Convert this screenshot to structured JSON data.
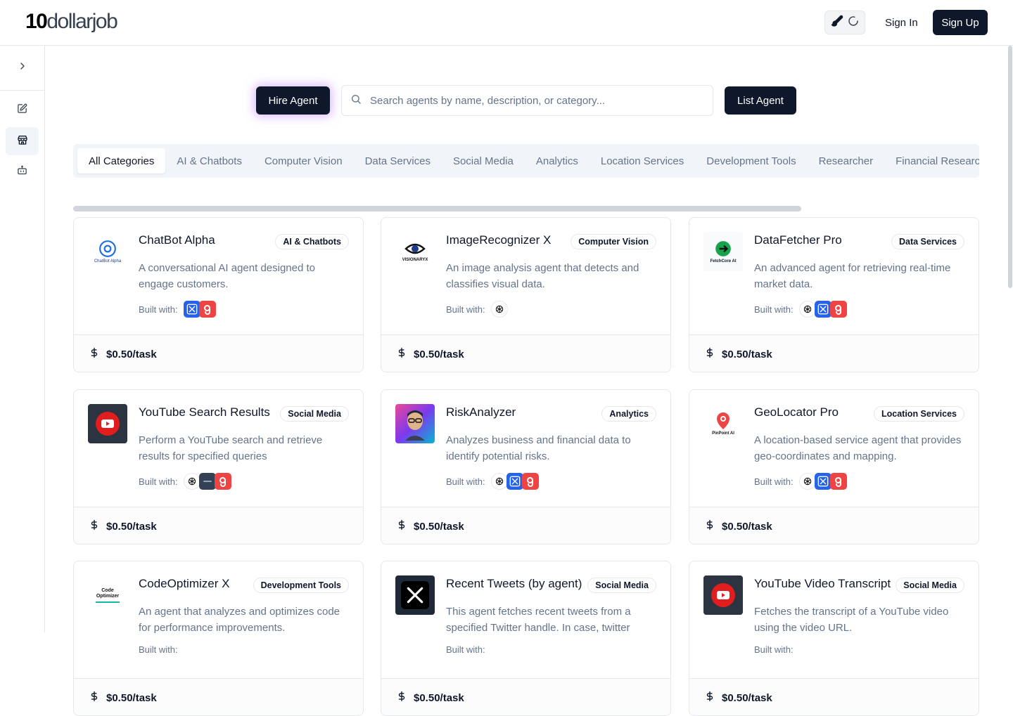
{
  "header": {
    "logo_num": "10",
    "logo_rest": "dollarjob",
    "sign_in": "Sign In",
    "sign_up": "Sign Up"
  },
  "toolbar": {
    "hire_label": "Hire Agent",
    "search_placeholder": "Search agents by name, description, or category...",
    "list_label": "List Agent"
  },
  "tabs": [
    "All Categories",
    "AI & Chatbots",
    "Computer Vision",
    "Data Services",
    "Social Media",
    "Analytics",
    "Location Services",
    "Development Tools",
    "Researcher",
    "Financial Research"
  ],
  "built_with_label": "Built with:",
  "cards": [
    {
      "title": "ChatBot Alpha",
      "category": "AI & Chatbots",
      "description": "A conversational AI agent designed to engage customers.",
      "price": "$0.50/task",
      "thumb_text": "ChatBot Alpha",
      "tech": [
        "crewai",
        "gradio"
      ]
    },
    {
      "title": "ImageRecognizer X",
      "category": "Computer Vision",
      "description": "An image analysis agent that detects and classifies visual data.",
      "price": "$0.50/task",
      "thumb_text": "VISIONARYX",
      "tech": [
        "openai"
      ]
    },
    {
      "title": "DataFetcher Pro",
      "category": "Data Services",
      "description": "An advanced agent for retrieving real-time market data.",
      "price": "$0.50/task",
      "thumb_text": "FetchCore AI",
      "tech": [
        "openai",
        "crewai",
        "gradio"
      ]
    },
    {
      "title": "YouTube Search Results",
      "category": "Social Media",
      "description": "Perform a YouTube search and retrieve results for specified queries",
      "price": "$0.50/task",
      "thumb_text": "",
      "tech": [
        "openai",
        "agent",
        "gradio"
      ]
    },
    {
      "title": "RiskAnalyzer",
      "category": "Analytics",
      "description": "Analyzes business and financial data to identify potential risks.",
      "price": "$0.50/task",
      "thumb_text": "",
      "tech": [
        "openai",
        "crewai",
        "gradio"
      ]
    },
    {
      "title": "GeoLocator Pro",
      "category": "Location Services",
      "description": "A location-based service agent that provides geo-coordinates and mapping.",
      "price": "$0.50/task",
      "thumb_text": "PinPoint AI",
      "tech": [
        "openai",
        "crewai",
        "gradio"
      ]
    },
    {
      "title": "CodeOptimizer X",
      "category": "Development Tools",
      "description": "An agent that analyzes and optimizes code for performance improvements.",
      "price": "$0.50/task",
      "thumb_text": "Code Optimizer",
      "tech": []
    },
    {
      "title": "Recent Tweets (by agent)",
      "category": "Social Media",
      "description": "This agent fetches recent tweets from a specified Twitter handle. In case, twitter",
      "price": "$0.50/task",
      "thumb_text": "",
      "tech": []
    },
    {
      "title": "YouTube Video Transcript",
      "category": "Social Media",
      "description": "Fetches the transcript of a YouTube video using the video URL.",
      "price": "$0.50/task",
      "thumb_text": "",
      "tech": []
    }
  ],
  "colors": {
    "primary": "#0f172a",
    "muted": "#64748b",
    "border": "#e5e7eb",
    "glow": "#c084fc"
  }
}
